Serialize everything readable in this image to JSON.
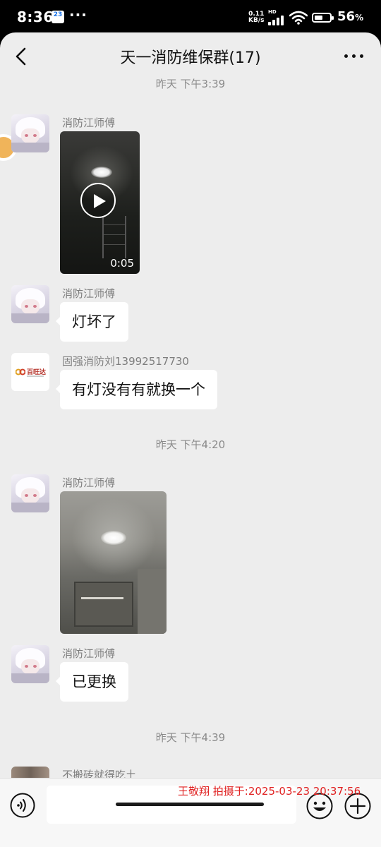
{
  "status_bar": {
    "time": "8:36",
    "calendar_badge": "23",
    "more_dots": "···",
    "net_speed_value": "0.11",
    "net_speed_unit": "KB/s",
    "hd_label": "HD",
    "battery_percent": "56",
    "battery_unit": "%",
    "battery_level": 0.56
  },
  "header": {
    "title": "天一消防维保群(17)"
  },
  "messages": {
    "time_1": "昨天 下午3:39",
    "video_sender": "消防江师傅",
    "video_duration": "0:05",
    "msg_2_sender": "消防江师傅",
    "msg_2_text": "灯坏了",
    "msg_3_sender": "固强消防刘13992517730",
    "msg_3_text": "有灯没有有就换一个",
    "msg_3_avatar_brand": "百旺达",
    "time_2": "昨天 下午4:20",
    "photo_sender": "消防江师傅",
    "msg_5_sender": "消防江师傅",
    "msg_5_text": "已更换",
    "time_3": "昨天 下午4:39",
    "msg_6_sender": "不搬砖就得吃土"
  },
  "input": {
    "placeholder": ""
  },
  "watermark": "王敬翔 拍摄于:2025-03-23 20:37:56",
  "colors": {
    "chat_background": "#ededed",
    "bubble": "#ffffff",
    "watermark": "#e02020"
  },
  "icons": [
    "calendar-badge-icon",
    "signal-icon",
    "wifi-icon",
    "battery-icon",
    "back-icon",
    "more-icon",
    "play-icon",
    "voice-icon",
    "emoji-icon",
    "plus-icon"
  ]
}
